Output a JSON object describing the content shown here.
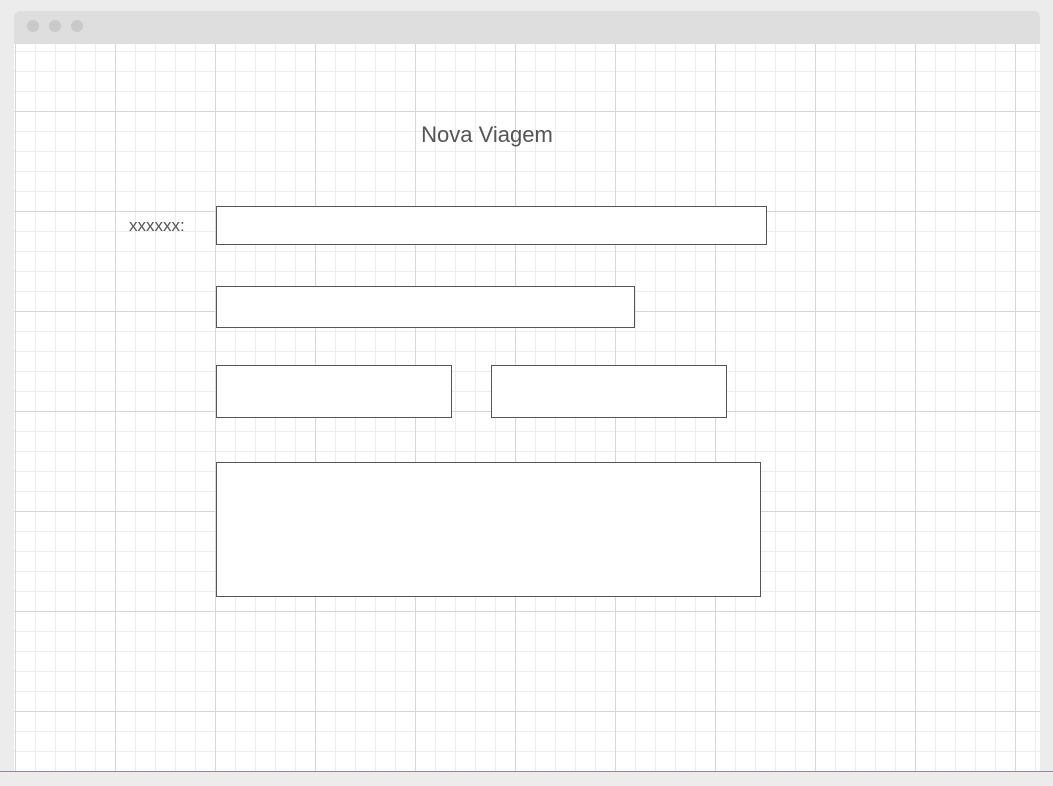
{
  "form": {
    "title": "Nova Viagem",
    "field_label": "xxxxxx:"
  }
}
